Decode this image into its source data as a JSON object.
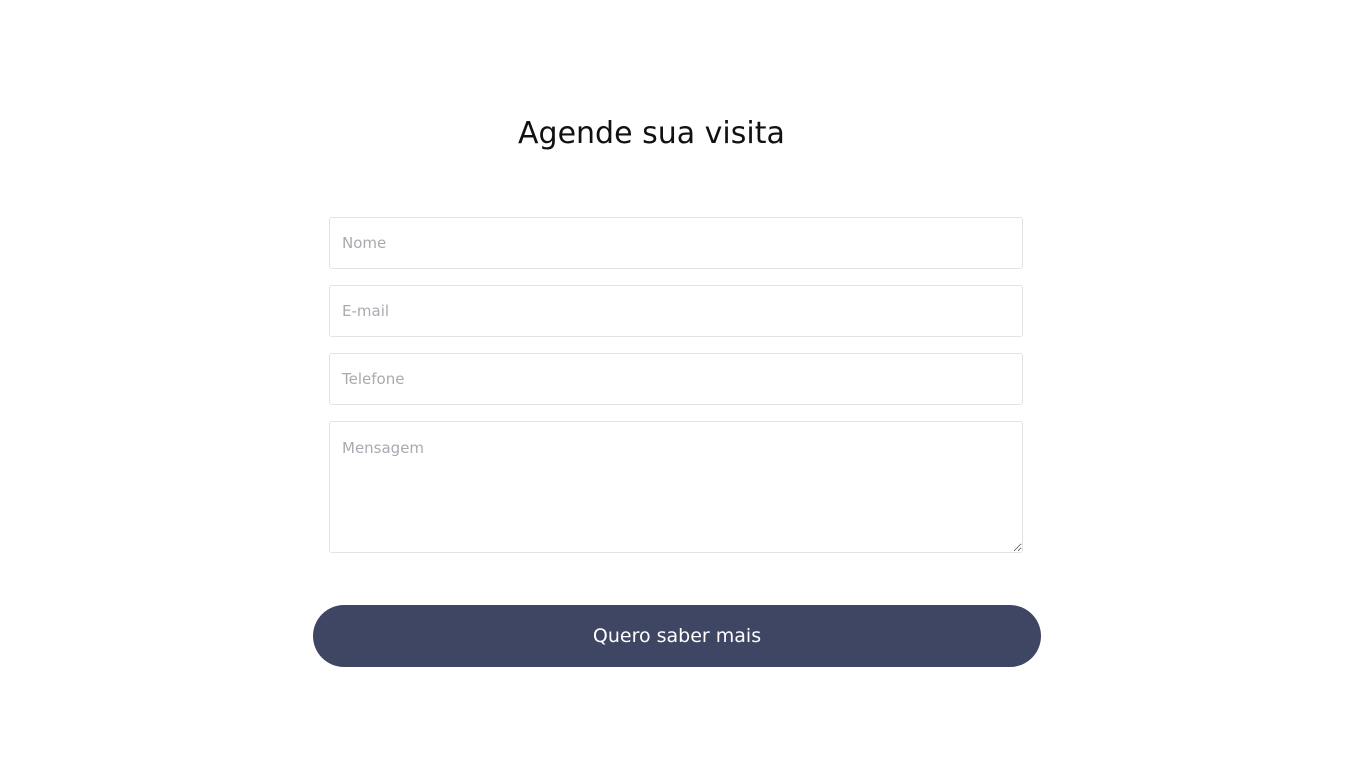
{
  "form": {
    "title": "Agende sua visita",
    "fields": {
      "nome": {
        "placeholder": "Nome",
        "value": ""
      },
      "email": {
        "placeholder": "E-mail",
        "value": ""
      },
      "telefone": {
        "placeholder": "Telefone",
        "value": ""
      },
      "mensagem": {
        "placeholder": "Mensagem",
        "value": ""
      }
    },
    "submit_label": "Quero saber mais"
  },
  "colors": {
    "button_background": "#3e4663",
    "button_text": "#ffffff",
    "placeholder": "#a8aab0",
    "field_border": "#e3e3e3"
  }
}
